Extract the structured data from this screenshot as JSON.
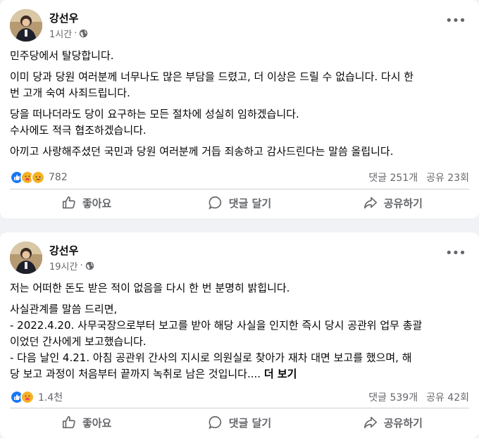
{
  "posts": [
    {
      "author": "강선우",
      "time": "1시간",
      "privacy_icon": "globe-icon",
      "paragraphs": [
        [
          "민주당에서 탈당합니다."
        ],
        [
          "이미 당과 당원 여러분께 너무나도 많은 부담을 드렸고, 더 이상은 드릴 수 없습니다. 다시 한",
          "번 고개 숙여 사죄드립니다."
        ],
        [
          "당을 떠나더라도 당이 요구하는 모든 절차에 성실히 임하겠습니다.",
          "수사에도 적극 협조하겠습니다."
        ],
        [
          "아끼고 사랑해주셨던 국민과 당원 여러분께 거듭 죄송하고 감사드린다는 말씀 올립니다."
        ]
      ],
      "reactions": {
        "icons": [
          "like",
          "care",
          "sad"
        ],
        "count": "782"
      },
      "comments": "댓글 251개",
      "shares": "공유 23회"
    },
    {
      "author": "강선우",
      "time": "19시간",
      "privacy_icon": "globe-icon",
      "paragraphs": [
        [
          "저는 어떠한 돈도 받은 적이 없음을 다시 한 번 분명히 밝힙니다."
        ],
        [
          "사실관계를 말씀 드리면,",
          "- 2022.4.20. 사무국장으로부터 보고를 받아 해당 사실을 인지한 즉시 당시 공관위 업무 총괄",
          "이었던 간사에게 보고했습니다.",
          "- 다음 날인 4.21. 아침 공관위 간사의 지시로 의원실로 찾아가 재차 대면 보고를 했으며, 해",
          "당 보고 과정이 처음부터 끝까지 녹취로 남은 것입니다...."
        ]
      ],
      "see_more": "더 보기",
      "reactions": {
        "icons": [
          "like",
          "care"
        ],
        "count": "1.4천"
      },
      "comments": "댓글 539개",
      "shares": "공유 42회"
    }
  ],
  "actions": {
    "like": "좋아요",
    "comment": "댓글 달기",
    "share": "공유하기"
  },
  "colors": {
    "like": "#1877f2",
    "care": "#f7b125",
    "sad": "#f7b125",
    "muted": "#65676b"
  }
}
